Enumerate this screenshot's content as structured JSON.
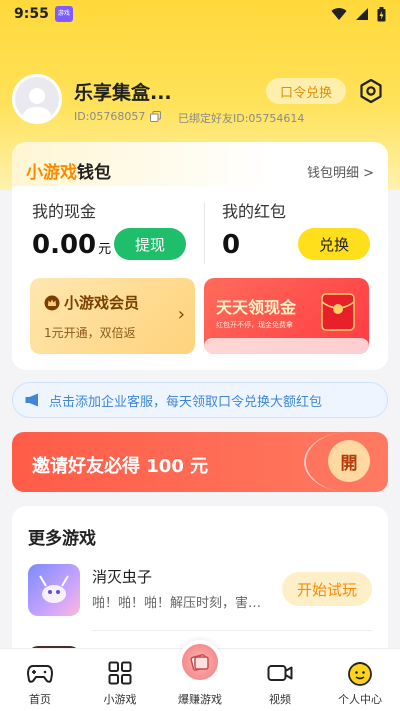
{
  "status_bar": {
    "time": "9:55",
    "app_badge": "游戏"
  },
  "profile": {
    "nickname": "乐享集盒...",
    "user_id": "ID:05768057",
    "bound_friend": "已绑定好友ID:05754614",
    "redeem_label": "口令兑换"
  },
  "wallet": {
    "title_prefix": "小游戏",
    "title_suffix": "钱包",
    "detail_link": "钱包明细 >",
    "cash_label": "我的现金",
    "cash_value": "0.00",
    "cash_unit": "元",
    "withdraw_label": "提现",
    "redpack_label": "我的红包",
    "redpack_value": "0",
    "exchange_label": "兑换",
    "vip_title": "小游戏会员",
    "vip_sub": "1元开通，双倍返",
    "cash_card_title": "天天领现金",
    "cash_card_sub": "红包开不停，现金免费拿"
  },
  "notice": {
    "text": "点击添加企业客服，每天领取口令兑换大额红包"
  },
  "invite": {
    "text": "邀请好友必得 100 元",
    "open_label": "開"
  },
  "games": {
    "title": "更多游戏",
    "items": [
      {
        "name": "消灭虫子",
        "desc": "啪！啪！啪！解压时刻，害虫...",
        "action": "开始试玩"
      }
    ]
  },
  "tabbar": {
    "items": [
      {
        "label": "首页",
        "icon": "gamepad-icon"
      },
      {
        "label": "小游戏",
        "icon": "grid-icon"
      },
      {
        "label": "爆赚游戏",
        "icon": "money-icon"
      },
      {
        "label": "视频",
        "icon": "video-icon"
      },
      {
        "label": "个人中心",
        "icon": "smile-icon"
      }
    ]
  },
  "colors": {
    "brand_yellow": "#ffde1c",
    "green": "#1fbe6a",
    "orange": "#ff8a00",
    "invite_red": "#ff5c48",
    "notice_blue": "#3f86d8"
  }
}
